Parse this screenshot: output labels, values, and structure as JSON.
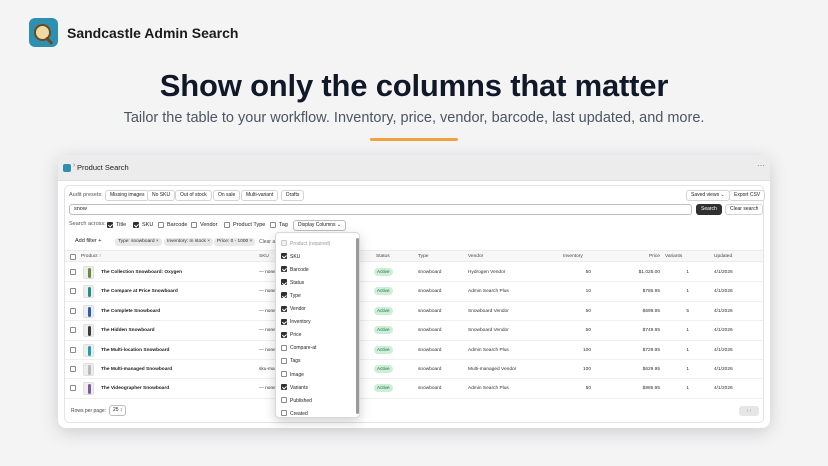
{
  "brand": {
    "name": "Sandcastle Admin Search",
    "icon": "sandcastle-magnifier-logo"
  },
  "hero": {
    "title": "Show only the columns that matter",
    "subtitle": "Tailor the table to your workflow. Inventory, price, vendor, barcode, last updated, and more.",
    "accent_color": "#f2a23c"
  },
  "app": {
    "title": "Product Search",
    "more_icon": "···",
    "audit_presets_label": "Audit presets:",
    "presets": [
      "Missing images",
      "No SKU",
      "Out of stock",
      "On sale",
      "Multi-variant",
      "Drafts"
    ],
    "saved_views_label": "Saved views ⌄",
    "export_csv_label": "Export CSV",
    "search": {
      "value": "snow",
      "button_label": "Search",
      "clear_label": "Clear search"
    },
    "search_across": {
      "label": "Search across:",
      "options": [
        {
          "label": "Title",
          "checked": true
        },
        {
          "label": "SKU",
          "checked": true
        },
        {
          "label": "Barcode",
          "checked": false
        },
        {
          "label": "Vendor",
          "checked": false
        },
        {
          "label": "Product Type",
          "checked": false
        },
        {
          "label": "Tag",
          "checked": false
        }
      ],
      "display_columns_label": "Display Columns ⌄"
    },
    "filters": {
      "add_filter_label": "Add filter +",
      "chips": [
        "Type: snowboard ×",
        "Inventory: In stock ×",
        "Price: 0 - 1000 ×"
      ],
      "clear_all_label": "Clear all"
    },
    "table": {
      "headers": {
        "product": "Product ↑",
        "sku": "SKU",
        "status": "Status",
        "type": "Type",
        "vendor": "Vendor",
        "inventory": "Inventory",
        "price": "Price",
        "variants": "Variants",
        "updated": "Updated"
      },
      "rows": [
        {
          "name": "The Collection Snowboard: Oxygen",
          "sku": "— none",
          "status": "Active",
          "type": "snowboard",
          "vendor": "Hydrogen Vendor",
          "inventory": "50",
          "price": "$1,025.00",
          "variants": "1",
          "updated": "4/1/2026",
          "thumb_color": "#6a8a3a"
        },
        {
          "name": "The Compare at Price Snowboard",
          "sku": "— none",
          "status": "Active",
          "type": "snowboard",
          "vendor": "Admin Search Plus",
          "inventory": "10",
          "price": "$785.95",
          "variants": "1",
          "updated": "4/1/2026",
          "thumb_color": "#1f8f8a"
        },
        {
          "name": "The Complete Snowboard",
          "sku": "— none",
          "status": "Active",
          "type": "snowboard",
          "vendor": "Snowboard Vendor",
          "inventory": "50",
          "price": "$699.95",
          "variants": "5",
          "updated": "4/1/2026",
          "thumb_color": "#2a5fb0"
        },
        {
          "name": "The Hidden Snowboard",
          "sku": "— none",
          "status": "Active",
          "type": "snowboard",
          "vendor": "Snowboard Vendor",
          "inventory": "50",
          "price": "$749.95",
          "variants": "1",
          "updated": "4/1/2026",
          "thumb_color": "#3a3a3a"
        },
        {
          "name": "The Multi-location Snowboard",
          "sku": "— none",
          "status": "Active",
          "type": "snowboard",
          "vendor": "Admin Search Plus",
          "inventory": "100",
          "price": "$729.95",
          "variants": "1",
          "updated": "4/1/2026",
          "thumb_color": "#1fa0a8"
        },
        {
          "name": "The Multi-managed Snowboard",
          "sku": "sku-ma",
          "status": "Active",
          "type": "snowboard",
          "vendor": "Multi-managed Vendor",
          "inventory": "100",
          "price": "$629.95",
          "variants": "1",
          "updated": "4/1/2026",
          "thumb_color": "#b8b8b8"
        },
        {
          "name": "The Videographer Snowboard",
          "sku": "— none",
          "status": "Active",
          "type": "snowboard",
          "vendor": "Admin Search Plus",
          "inventory": "50",
          "price": "$885.95",
          "variants": "1",
          "updated": "4/1/2026",
          "thumb_color": "#7a5a9a"
        }
      ]
    },
    "pagination": {
      "rows_per_page_label": "Rows per page:",
      "rows_per_page_value": "25 ↕",
      "pager_label": "‹ ›"
    },
    "display_columns_menu": [
      {
        "label": "Product (required)",
        "checked": false,
        "disabled": true
      },
      {
        "label": "SKU",
        "checked": true
      },
      {
        "label": "Barcode",
        "checked": true
      },
      {
        "label": "Status",
        "checked": true
      },
      {
        "label": "Type",
        "checked": true
      },
      {
        "label": "Vendor",
        "checked": true
      },
      {
        "label": "Inventory",
        "checked": true
      },
      {
        "label": "Price",
        "checked": true
      },
      {
        "label": "Compare-at",
        "checked": false
      },
      {
        "label": "Tags",
        "checked": false
      },
      {
        "label": "Image",
        "checked": false
      },
      {
        "label": "Variants",
        "checked": true
      },
      {
        "label": "Published",
        "checked": false
      },
      {
        "label": "Created",
        "checked": false
      }
    ]
  }
}
